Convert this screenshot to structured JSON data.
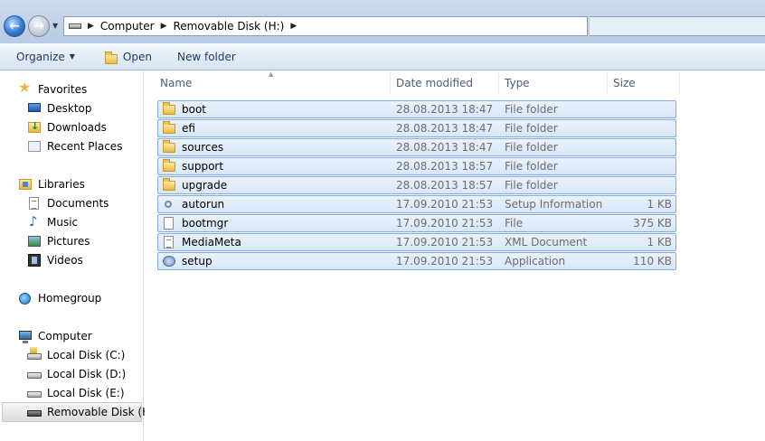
{
  "address": {
    "crumbs": [
      "Computer",
      "Removable Disk (H:)"
    ]
  },
  "toolbar": {
    "organize_label": "Organize",
    "open_label": "Open",
    "new_folder_label": "New folder"
  },
  "nav": {
    "favorites": {
      "label": "Favorites",
      "items": [
        "Desktop",
        "Downloads",
        "Recent Places"
      ]
    },
    "libraries": {
      "label": "Libraries",
      "items": [
        "Documents",
        "Music",
        "Pictures",
        "Videos"
      ]
    },
    "homegroup": {
      "label": "Homegroup"
    },
    "computer": {
      "label": "Computer",
      "items": [
        "Local Disk (C:)",
        "Local Disk (D:)",
        "Local Disk (E:)",
        "Removable Disk (H:)"
      ]
    }
  },
  "columns": {
    "name": "Name",
    "date": "Date modified",
    "type": "Type",
    "size": "Size"
  },
  "files": [
    {
      "name": "boot",
      "date": "28.08.2013 18:47",
      "type": "File folder",
      "size": "",
      "icon": "folder-icon"
    },
    {
      "name": "efi",
      "date": "28.08.2013 18:47",
      "type": "File folder",
      "size": "",
      "icon": "folder-icon"
    },
    {
      "name": "sources",
      "date": "28.08.2013 18:47",
      "type": "File folder",
      "size": "",
      "icon": "folder-icon"
    },
    {
      "name": "support",
      "date": "28.08.2013 18:57",
      "type": "File folder",
      "size": "",
      "icon": "folder-icon"
    },
    {
      "name": "upgrade",
      "date": "28.08.2013 18:57",
      "type": "File folder",
      "size": "",
      "icon": "folder-icon"
    },
    {
      "name": "autorun",
      "date": "17.09.2010 21:53",
      "type": "Setup Information",
      "size": "1 KB",
      "icon": "setup-info-icon"
    },
    {
      "name": "bootmgr",
      "date": "17.09.2010 21:53",
      "type": "File",
      "size": "375 KB",
      "icon": "file-icon"
    },
    {
      "name": "MediaMeta",
      "date": "17.09.2010 21:53",
      "type": "XML Document",
      "size": "1 KB",
      "icon": "xml-document-icon"
    },
    {
      "name": "setup",
      "date": "17.09.2010 21:53",
      "type": "Application",
      "size": "110 KB",
      "icon": "application-icon"
    }
  ]
}
